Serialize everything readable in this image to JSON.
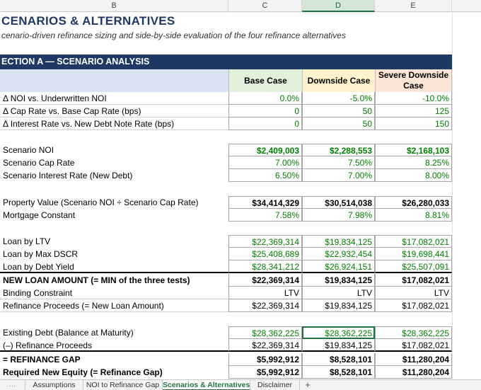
{
  "columns": [
    "B",
    "C",
    "D",
    "E"
  ],
  "title": "CENARIOS & ALTERNATIVES",
  "subtitle": "cenario-driven refinance sizing and side-by-side evaluation of the four refinance alternatives",
  "section": "ECTION A — SCENARIO ANALYSIS",
  "headers": {
    "base": "Base Case",
    "downside": "Downside Case",
    "severe": "Severe Downside Case"
  },
  "rows": [
    {
      "label": "Δ NOI vs. Underwritten NOI",
      "base": "0.0%",
      "down": "-5.0%",
      "sev": "-10.0%"
    },
    {
      "label": "Δ Cap Rate vs. Base Cap Rate (bps)",
      "base": "0",
      "down": "50",
      "sev": "125"
    },
    {
      "label": "Δ Interest Rate vs. New Debt Note Rate (bps)",
      "base": "0",
      "down": "50",
      "sev": "150"
    },
    {
      "label": "Scenario NOI",
      "base": "$2,409,003",
      "down": "$2,288,553",
      "sev": "$2,168,103"
    },
    {
      "label": "Scenario Cap Rate",
      "base": "7.00%",
      "down": "7.50%",
      "sev": "8.25%"
    },
    {
      "label": "Scenario Interest Rate (New Debt)",
      "base": "6.50%",
      "down": "7.00%",
      "sev": "8.00%"
    },
    {
      "label": "Property Value  (Scenario NOI ÷ Scenario Cap Rate)",
      "base": "$34,414,329",
      "down": "$30,514,038",
      "sev": "$26,280,033"
    },
    {
      "label": "Mortgage Constant",
      "base": "7.58%",
      "down": "7.98%",
      "sev": "8.81%"
    },
    {
      "label": "Loan by LTV",
      "base": "$22,369,314",
      "down": "$19,834,125",
      "sev": "$17,082,021"
    },
    {
      "label": "Loan by Max DSCR",
      "base": "$25,408,689",
      "down": "$22,932,454",
      "sev": "$19,698,441"
    },
    {
      "label": "Loan by Debt Yield",
      "base": "$28,341,212",
      "down": "$26,924,151",
      "sev": "$25,507,091"
    },
    {
      "label": "NEW LOAN AMOUNT  (= MIN of the three tests)",
      "base": "$22,369,314",
      "down": "$19,834,125",
      "sev": "$17,082,021"
    },
    {
      "label": "Binding Constraint",
      "base": "LTV",
      "down": "LTV",
      "sev": "LTV"
    },
    {
      "label": "Refinance Proceeds  (= New Loan Amount)",
      "base": "$22,369,314",
      "down": "$19,834,125",
      "sev": "$17,082,021"
    },
    {
      "label": "Existing Debt  (Balance at Maturity)",
      "base": "$28,362,225",
      "down": "$28,362,225",
      "sev": "$28,362,225"
    },
    {
      "label": "(–) Refinance Proceeds",
      "base": "$22,369,314",
      "down": "$19,834,125",
      "sev": "$17,082,021"
    },
    {
      "label": " = REFINANCE GAP",
      "base": "$5,992,912",
      "down": "$8,528,101",
      "sev": "$11,280,204"
    },
    {
      "label": "Required New Equity  (= Refinance Gap)",
      "base": "$5,992,912",
      "down": "$8,528,101",
      "sev": "$11,280,204"
    }
  ],
  "tabs": {
    "edge": "…",
    "t1": "Assumptions",
    "t2": "NOI to Refinance Gap",
    "t3": "Scenarios & Alternatives",
    "t4": "Disclaimer",
    "plus": "+"
  }
}
